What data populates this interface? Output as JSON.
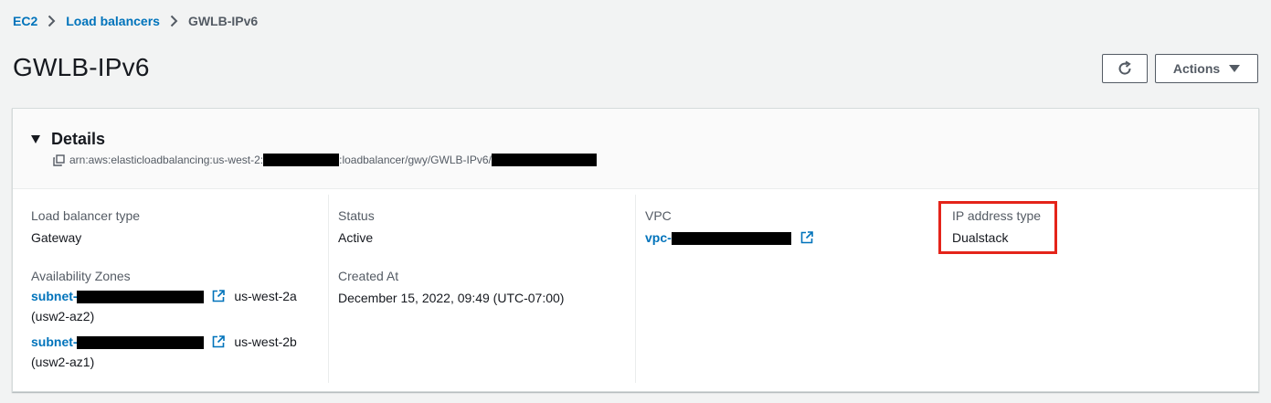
{
  "breadcrumb": {
    "items": [
      "EC2",
      "Load balancers",
      "GWLB-IPv6"
    ]
  },
  "page": {
    "title": "GWLB-IPv6",
    "actions_label": "Actions"
  },
  "details": {
    "title": "Details",
    "arn_prefix": "arn:aws:elasticloadbalancing:us-west-2:",
    "arn_middle": ":loadbalancer/gwy/GWLB-IPv6/"
  },
  "fields": {
    "lb_type_label": "Load balancer type",
    "lb_type_value": "Gateway",
    "az_label": "Availability Zones",
    "subnets": [
      {
        "prefix": "subnet-",
        "zone": "us-west-2a",
        "zone_id": "(usw2-az2)"
      },
      {
        "prefix": "subnet-",
        "zone": "us-west-2b",
        "zone_id": "(usw2-az1)"
      }
    ],
    "status_label": "Status",
    "status_value": "Active",
    "created_label": "Created At",
    "created_value": "December 15, 2022, 09:49 (UTC-07:00)",
    "vpc_label": "VPC",
    "vpc_prefix": "vpc-",
    "ip_type_label": "IP address type",
    "ip_type_value": "Dualstack"
  },
  "colors": {
    "link": "#0073bb",
    "highlight": "#e4241a",
    "background": "#f2f3f3"
  },
  "icons": [
    "chevron-right-icon",
    "refresh-icon",
    "caret-down-icon",
    "triangle-down-icon",
    "copy-icon",
    "external-link-icon"
  ]
}
